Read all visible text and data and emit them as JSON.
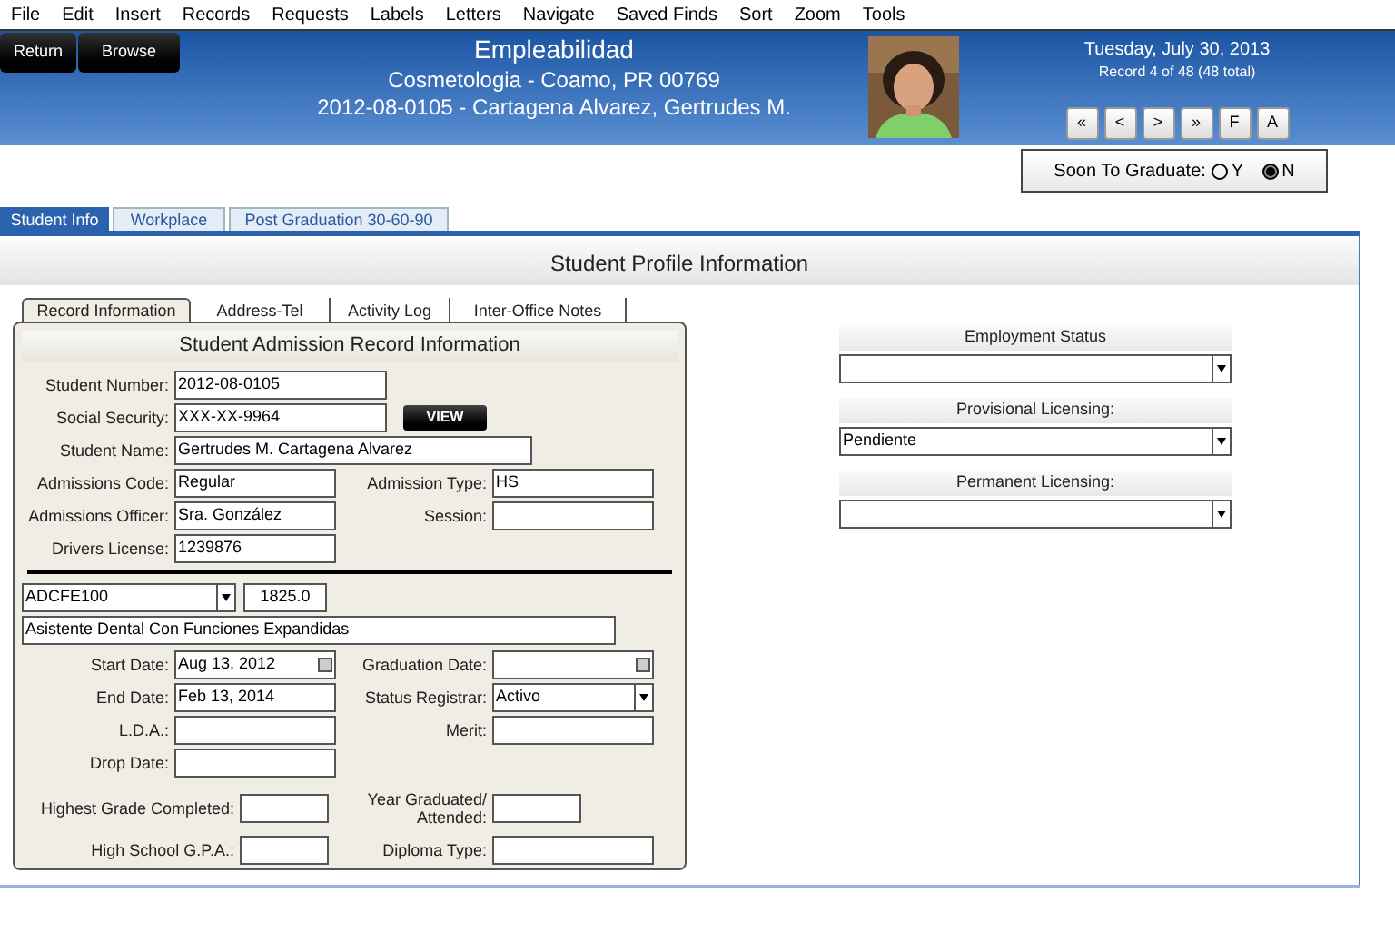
{
  "menu": [
    "File",
    "Edit",
    "Insert",
    "Records",
    "Requests",
    "Labels",
    "Letters",
    "Navigate",
    "Saved Finds",
    "Sort",
    "Zoom",
    "Tools"
  ],
  "header": {
    "buttons": [
      "Return",
      "Browse"
    ],
    "title": "Empleabilidad",
    "subtitle": "Cosmetologia  - Coamo, PR 00769",
    "record_line": "2012-08-0105 - Cartagena Alvarez, Gertrudes M.",
    "date": "Tuesday, July 30, 2013",
    "record_count": "Record 4 of 48 (48 total)",
    "nav_buttons": [
      "«",
      "<",
      ">",
      "»",
      "F",
      "A"
    ]
  },
  "soon_to_graduate": {
    "label": "Soon To Graduate:",
    "options": [
      {
        "label": "Y",
        "selected": false
      },
      {
        "label": "N",
        "selected": true
      }
    ]
  },
  "tabs": [
    {
      "label": "Student Info",
      "selected": true
    },
    {
      "label": "Workplace",
      "selected": false
    },
    {
      "label": "Post Graduation 30-60-90",
      "selected": false
    }
  ],
  "section_title": "Student Profile Information",
  "subtabs": [
    {
      "label": "Record Information",
      "selected": true
    },
    {
      "label": "Address-Tel",
      "selected": false
    },
    {
      "label": "Activity Log",
      "selected": false
    },
    {
      "label": "Inter-Office Notes",
      "selected": false
    }
  ],
  "admission": {
    "title": "Student Admission Record Information",
    "top_fields": [
      {
        "label": "Student Number:",
        "value": "2012-08-0105"
      },
      {
        "label": "Social Security:",
        "value": "XXX-XX-9964"
      },
      {
        "label": "Student Name:",
        "value": "Gertrudes M. Cartagena Alvarez"
      }
    ],
    "view_button": "VIEW",
    "pairs": [
      {
        "left": {
          "label": "Admissions Code:",
          "value": "Regular"
        },
        "right": {
          "label": "Admission Type:",
          "value": "HS"
        }
      },
      {
        "left": {
          "label": "Admissions Officer:",
          "value": "Sra. González"
        },
        "right": {
          "label": "Session:"
        }
      },
      {
        "left": {
          "label": "Drivers License:",
          "value": "1239876"
        }
      }
    ],
    "program": {
      "code": "ADCFE100",
      "hours": "1825.0",
      "name": "Asistente Dental Con Funciones Expandidas"
    },
    "date_pairs": [
      {
        "left": {
          "label": "Start Date:",
          "value": "Aug 13, 2012",
          "kind": "date"
        },
        "right": {
          "label": "Graduation Date:",
          "kind": "date"
        }
      },
      {
        "left": {
          "label": "End Date:",
          "value": "Feb 13, 2014",
          "kind": "text"
        },
        "right": {
          "label": "Status Registrar:",
          "value": "Activo",
          "kind": "select"
        }
      },
      {
        "left": {
          "label": "L.D.A.:",
          "kind": "text"
        },
        "right": {
          "label": "Merit:",
          "kind": "text"
        }
      },
      {
        "left": {
          "label": "Drop Date:",
          "kind": "text"
        }
      }
    ],
    "school_pairs": [
      {
        "left": {
          "label": "Highest Grade Completed:"
        },
        "right": {
          "label": "Year Graduated/ Attended:",
          "kind": "short"
        }
      },
      {
        "left": {
          "label": "High School G.P.A.:"
        },
        "right": {
          "label": "Diploma Type:",
          "kind": "text"
        }
      }
    ]
  },
  "employment": [
    {
      "label": "Employment Status"
    },
    {
      "label": "Provisional Licensing:",
      "value": "Pendiente"
    },
    {
      "label": "Permanent Licensing:"
    }
  ]
}
